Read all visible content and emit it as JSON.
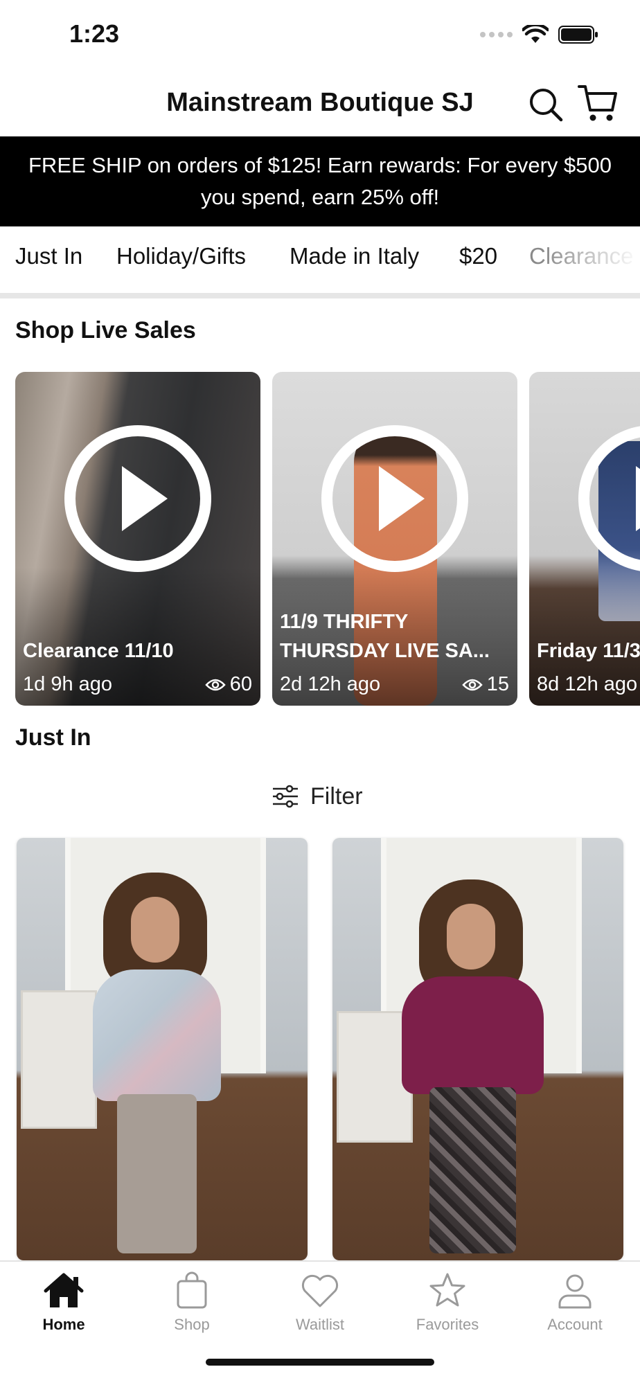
{
  "status_bar": {
    "time": "1:23"
  },
  "header": {
    "title": "Mainstream Boutique SJ"
  },
  "promo": {
    "text": "FREE SHIP on orders of $125! Earn rewards: For every $500 you spend, earn 25% off!"
  },
  "category_tabs": [
    {
      "label": "Just In",
      "active": true
    },
    {
      "label": "Holiday/Gifts",
      "active": false
    },
    {
      "label": "Made in Italy",
      "active": false
    },
    {
      "label": "$20",
      "active": false
    },
    {
      "label": "Clearance",
      "active": false
    }
  ],
  "live_sales": {
    "title": "Shop Live Sales",
    "items": [
      {
        "title": "Clearance 11/10",
        "ago": "1d 9h ago",
        "views": "60"
      },
      {
        "title": "11/9 THRIFTY\nTHURSDAY LIVE SA...",
        "ago": "2d 12h ago",
        "views": "15"
      },
      {
        "title": "Friday 11/3",
        "ago": "8d 12h ago",
        "views": ""
      }
    ]
  },
  "just_in": {
    "title": "Just In",
    "filter_label": "Filter"
  },
  "bottom_nav": [
    {
      "label": "Home",
      "icon": "home-icon",
      "active": true
    },
    {
      "label": "Shop",
      "icon": "shopping-bag-icon",
      "active": false
    },
    {
      "label": "Waitlist",
      "icon": "heart-icon",
      "active": false
    },
    {
      "label": "Favorites",
      "icon": "star-icon",
      "active": false
    },
    {
      "label": "Account",
      "icon": "person-icon",
      "active": false
    }
  ],
  "colors": {
    "accent": "#000000",
    "inactive": "#9a9a9a",
    "banner_bg": "#000000",
    "banner_text": "#ffffff"
  }
}
